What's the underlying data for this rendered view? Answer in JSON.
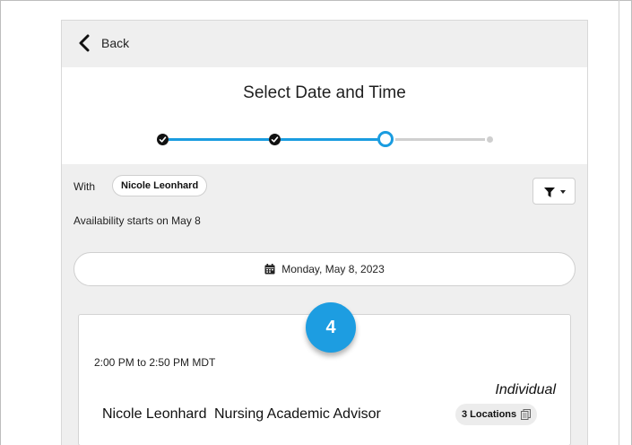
{
  "nav": {
    "back_label": "Back"
  },
  "header": {
    "title": "Select Date and Time"
  },
  "stepper": {
    "total_steps": 4,
    "current_step": 3
  },
  "colors": {
    "accent": "#1a9ce0",
    "badge": "#1d9de1",
    "panel_bg": "#efefef"
  },
  "filters": {
    "with_label": "With",
    "person": "Nicole Leonhard",
    "filter_icon": "filter-icon"
  },
  "availability": {
    "text": "Availability starts on May 8"
  },
  "date_picker": {
    "icon": "calendar-icon",
    "selected_date": "Monday, May 8, 2023"
  },
  "slot": {
    "time": "2:00 PM to 2:50 PM MDT",
    "type": "Individual",
    "advisor_name": "Nicole Leonhard",
    "advisor_role": "Nursing Academic Advisor",
    "locations_label": "3 Locations",
    "locations_icon": "copy-icon"
  },
  "callout": {
    "number": "4"
  }
}
